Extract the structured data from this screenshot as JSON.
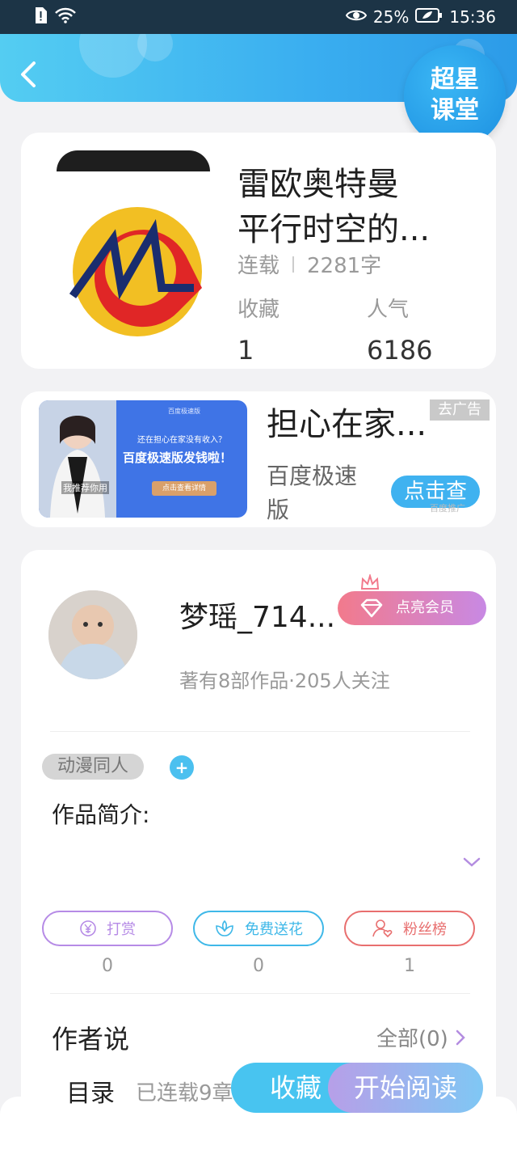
{
  "status_bar": {
    "battery": "25%",
    "time": "15:36"
  },
  "header": {
    "logo_line1": "超星",
    "logo_line2": "课堂"
  },
  "book": {
    "title_line1": "雷欧奥特曼",
    "title_line2": "平行时空的...",
    "status": "连载",
    "word_count": "2281字",
    "favorites_label": "收藏",
    "favorites_value": "1",
    "popularity_label": "人气",
    "popularity_value": "6186"
  },
  "ad": {
    "title": "担心在家...",
    "close_label": "去广告",
    "advertiser": "百度极速版",
    "cta": "点击查",
    "tag": "百度推广",
    "image_top": "百度极速版",
    "image_question": "还在担心在家没有收入？",
    "image_headline": "百度极速版发钱啦！",
    "image_button": "点击查看详情",
    "image_caption": "我推荐你用"
  },
  "author": {
    "name": "梦瑶_714...",
    "vip_label": "点亮会员",
    "stats": "著有8部作品·205人关注",
    "tag": "动漫同人",
    "add_tag": "+",
    "intro_label": "作品简介:"
  },
  "actions": [
    {
      "label": "打赏",
      "count": "0",
      "color": "#b68be6"
    },
    {
      "label": "免费送花",
      "count": "0",
      "color": "#3fb8e8"
    },
    {
      "label": "粉丝榜",
      "count": "1",
      "color": "#e86f6f"
    }
  ],
  "author_says": {
    "label": "作者说",
    "all": "全部(0)"
  },
  "bottom": {
    "toc_label": "目录",
    "toc_info": "已连载9章",
    "favorite": "收藏",
    "read": "开始阅读"
  }
}
